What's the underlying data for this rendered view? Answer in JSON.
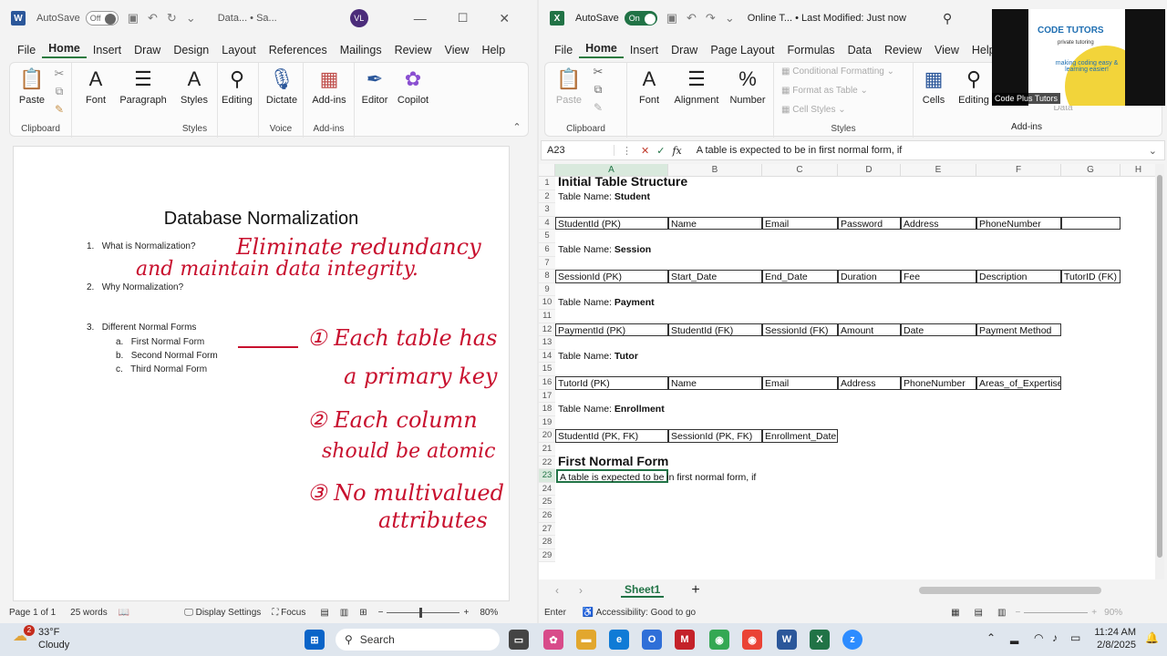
{
  "word": {
    "autosave": "AutoSave",
    "toggle": "Off",
    "doc": "Data... • Sa...",
    "avatar": "VL",
    "tabs": [
      "File",
      "Home",
      "Insert",
      "Draw",
      "Design",
      "Layout",
      "References",
      "Mailings",
      "Review",
      "View",
      "Help"
    ],
    "ribbon": {
      "paste": "Paste",
      "font": "Font",
      "paragraph": "Paragraph",
      "styles": "Styles",
      "editing": "Editing",
      "dictate": "Dictate",
      "addins": "Add-ins",
      "editor": "Editor",
      "copilot": "Copilot",
      "g_clipboard": "Clipboard",
      "g_styles": "Styles",
      "g_voice": "Voice",
      "g_addins": "Add-ins"
    },
    "page": {
      "title": "Database Normalization",
      "items": [
        {
          "n": "1.",
          "t": "What is Normalization?"
        },
        {
          "n": "2.",
          "t": "Why Normalization?"
        },
        {
          "n": "3.",
          "t": "Different Normal Forms"
        }
      ],
      "sub": [
        {
          "n": "a.",
          "t": "First Normal Form"
        },
        {
          "n": "b.",
          "t": "Second Normal Form"
        },
        {
          "n": "c.",
          "t": "Third Normal Form"
        }
      ],
      "hand": [
        "Eliminate redundancy",
        "and maintain data integrity.",
        "① Each table has",
        "a primary key",
        "② Each column",
        "should be atomic",
        "③ No multivalued",
        "attributes"
      ]
    },
    "status": {
      "page": "Page 1 of 1",
      "words": "25 words",
      "display": "Display Settings",
      "focus": "Focus",
      "zoom": "80%"
    }
  },
  "excel": {
    "autosave": "AutoSave",
    "toggle": "On",
    "doc": "Online T... • Last Modified: Just now",
    "tabs": [
      "File",
      "Home",
      "Insert",
      "Draw",
      "Page Layout",
      "Formulas",
      "Data",
      "Review",
      "View",
      "Help"
    ],
    "ribbon": {
      "paste": "Paste",
      "font": "Font",
      "alignment": "Alignment",
      "number": "Number",
      "cond": "Conditional Formatting",
      "table": "Format as Table",
      "cellstyles": "Cell Styles",
      "cells": "Cells",
      "editing": "Editing",
      "data": "Data",
      "g_clipboard": "Clipboard",
      "g_styles": "Styles",
      "g_addins": "Add-ins"
    },
    "namebox": "A23",
    "formula": "A table is expected to be in first normal form, if",
    "cols": [
      "A",
      "B",
      "C",
      "D",
      "E",
      "F",
      "G",
      "H"
    ],
    "rows": [
      {
        "r": "1",
        "cells": [
          {
            "t": "Initial Table Structure",
            "style": "big"
          }
        ]
      },
      {
        "r": "2",
        "cells": [
          {
            "t": "Table Name: ",
            "b": "Student"
          }
        ]
      },
      {
        "r": "3",
        "cells": []
      },
      {
        "r": "4",
        "cells": [
          {
            "t": "StudentId (PK)",
            "box": 1
          },
          {
            "t": "Name",
            "box": 1
          },
          {
            "t": "Email",
            "box": 1
          },
          {
            "t": "Password",
            "box": 1
          },
          {
            "t": "Address",
            "box": 1
          },
          {
            "t": "PhoneNumber",
            "box": 1
          },
          {
            "t": "",
            "box": 1
          }
        ]
      },
      {
        "r": "5",
        "cells": []
      },
      {
        "r": "6",
        "cells": [
          {
            "t": "Table Name: ",
            "b": "Session"
          }
        ]
      },
      {
        "r": "7",
        "cells": []
      },
      {
        "r": "8",
        "cells": [
          {
            "t": "SessionId (PK)",
            "box": 1
          },
          {
            "t": "Start_Date",
            "box": 1
          },
          {
            "t": "End_Date",
            "box": 1
          },
          {
            "t": "Duration",
            "box": 1
          },
          {
            "t": "Fee",
            "box": 1
          },
          {
            "t": "Description",
            "box": 1
          },
          {
            "t": "TutorID (FK)",
            "box": 1
          }
        ]
      },
      {
        "r": "9",
        "cells": []
      },
      {
        "r": "10",
        "cells": [
          {
            "t": "Table Name: ",
            "b": "Payment"
          }
        ]
      },
      {
        "r": "11",
        "cells": []
      },
      {
        "r": "12",
        "cells": [
          {
            "t": "PaymentId (PK)",
            "box": 1
          },
          {
            "t": "StudentId (FK)",
            "box": 1
          },
          {
            "t": "SessionId (FK)",
            "box": 1
          },
          {
            "t": "Amount",
            "box": 1
          },
          {
            "t": "Date",
            "box": 1
          },
          {
            "t": "Payment Method",
            "box": 1
          }
        ]
      },
      {
        "r": "13",
        "cells": []
      },
      {
        "r": "14",
        "cells": [
          {
            "t": "Table Name: ",
            "b": "Tutor"
          }
        ]
      },
      {
        "r": "15",
        "cells": []
      },
      {
        "r": "16",
        "cells": [
          {
            "t": "TutorId (PK)",
            "box": 1
          },
          {
            "t": "Name",
            "box": 1
          },
          {
            "t": "Email",
            "box": 1
          },
          {
            "t": "Address",
            "box": 1
          },
          {
            "t": "PhoneNumber",
            "box": 1
          },
          {
            "t": "Areas_of_Expertise",
            "box": 1
          }
        ]
      },
      {
        "r": "17",
        "cells": []
      },
      {
        "r": "18",
        "cells": [
          {
            "t": "Table Name: ",
            "b": "Enrollment"
          }
        ]
      },
      {
        "r": "19",
        "cells": []
      },
      {
        "r": "20",
        "cells": [
          {
            "t": "StudentId (PK, FK)",
            "box": 1
          },
          {
            "t": "SessionId (PK, FK)",
            "box": 1
          },
          {
            "t": "Enrollment_Date",
            "box": 1
          }
        ]
      },
      {
        "r": "21",
        "cells": []
      },
      {
        "r": "22",
        "cells": [
          {
            "t": "First Normal Form",
            "style": "big"
          }
        ]
      },
      {
        "r": "23",
        "cells": [
          {
            "t": "A table is expected to be in first normal form, if",
            "style": "sel"
          }
        ]
      },
      {
        "r": "24",
        "cells": []
      },
      {
        "r": "25",
        "cells": []
      },
      {
        "r": "26",
        "cells": []
      },
      {
        "r": "27",
        "cells": []
      },
      {
        "r": "28",
        "cells": []
      },
      {
        "r": "29",
        "cells": []
      }
    ],
    "sheet": "Sheet1",
    "status": {
      "mode": "Enter",
      "access": "Accessibility: Good to go",
      "zoom": "90%"
    }
  },
  "ad": {
    "brand": "CODE TUTORS",
    "tag": "private tutoring",
    "slogan": "making coding easy & learning easier!",
    "caption": "Code Plus Tutors"
  },
  "taskbar": {
    "temp": "33°F",
    "weather": "Cloudy",
    "badge": "2",
    "search": "Search",
    "time": "11:24 AM",
    "date": "2/8/2025"
  },
  "colors": {
    "word": "#2b579a",
    "excel": "#217346",
    "ink": "#c8102e"
  }
}
